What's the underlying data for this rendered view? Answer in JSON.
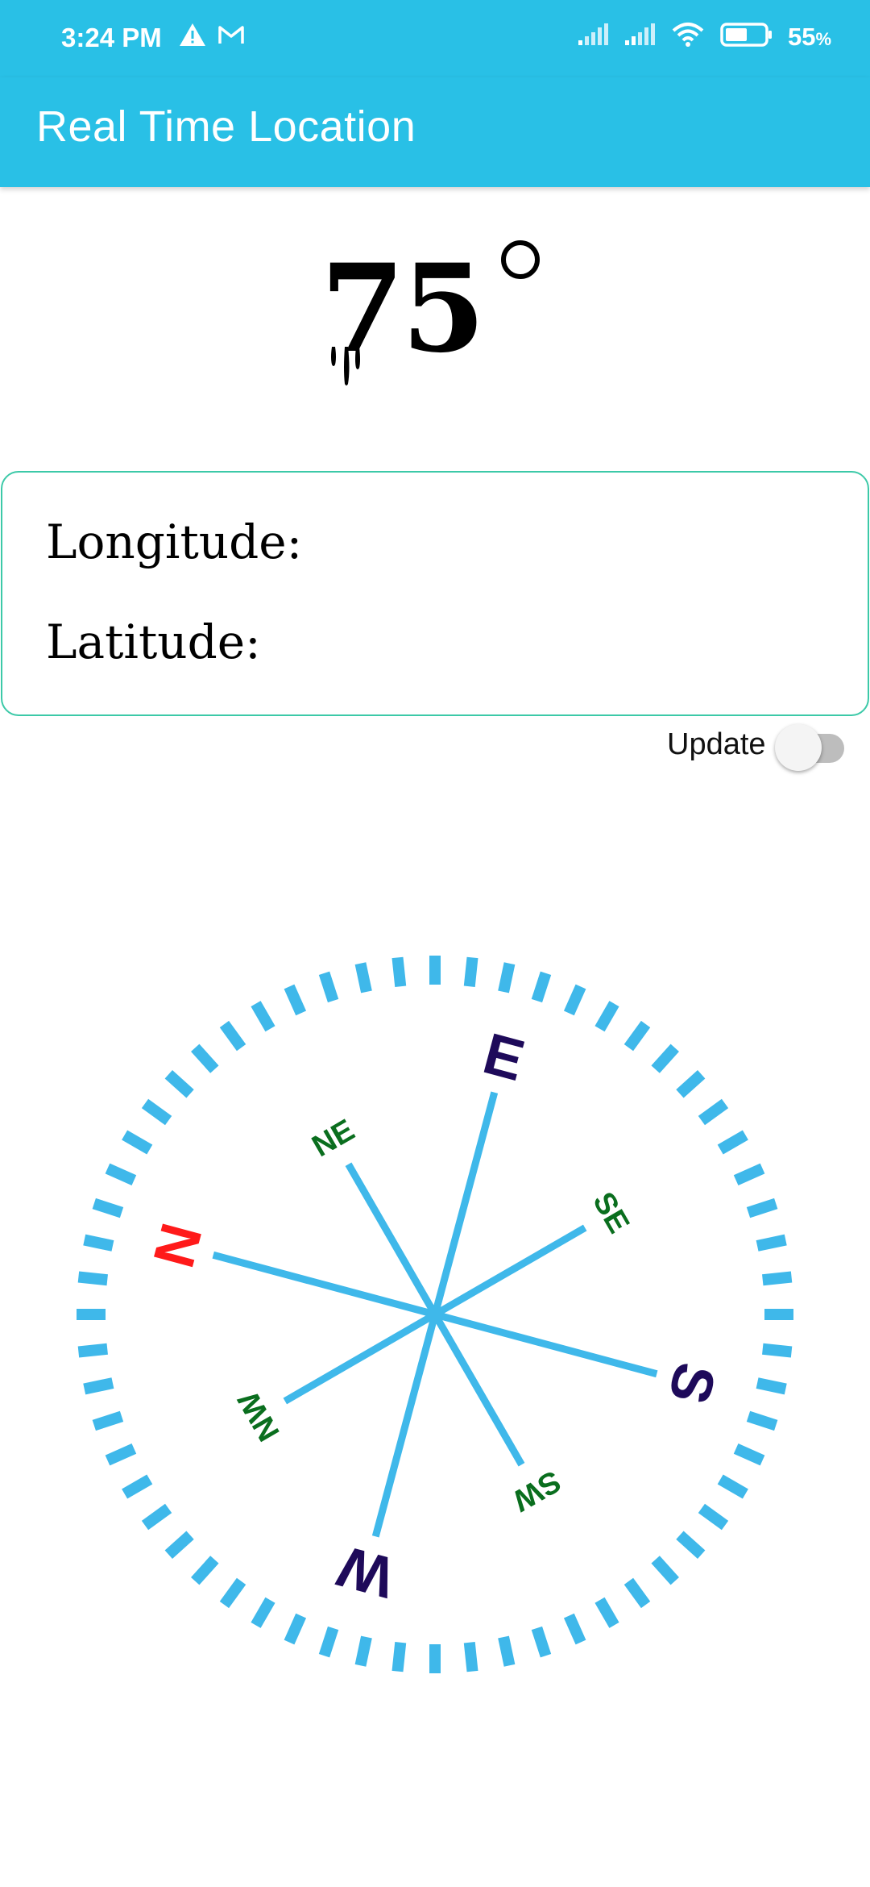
{
  "status_bar": {
    "time": "3:24 PM",
    "battery_percent": "55",
    "battery_percent_sign": "%",
    "icons": [
      "warning-icon",
      "gmail-icon",
      "signal-icon",
      "signal-icon",
      "wifi-icon",
      "battery-icon"
    ]
  },
  "app_bar": {
    "title": "Real Time Location",
    "background_color": "#29C0E6"
  },
  "heading": {
    "value": "75",
    "unit_symbol": "degree"
  },
  "location": {
    "longitude_label": "Longitude:",
    "latitude_label": "Latitude:"
  },
  "update_toggle": {
    "label": "Update",
    "state": "off"
  },
  "compass": {
    "rotation_degrees": 75,
    "cardinals": [
      {
        "label": "N",
        "color": "#ff1a1a"
      },
      {
        "label": "E",
        "color": "#1e0a5a"
      },
      {
        "label": "S",
        "color": "#1e0a5a"
      },
      {
        "label": "W",
        "color": "#1e0a5a"
      }
    ],
    "intercardinals": [
      {
        "label": "NE",
        "color": "#0a6e1e"
      },
      {
        "label": "SE",
        "color": "#0a6e1e"
      },
      {
        "label": "SW",
        "color": "#0a6e1e"
      },
      {
        "label": "NW",
        "color": "#0a6e1e"
      }
    ],
    "accent_color": "#3fb8ea"
  }
}
